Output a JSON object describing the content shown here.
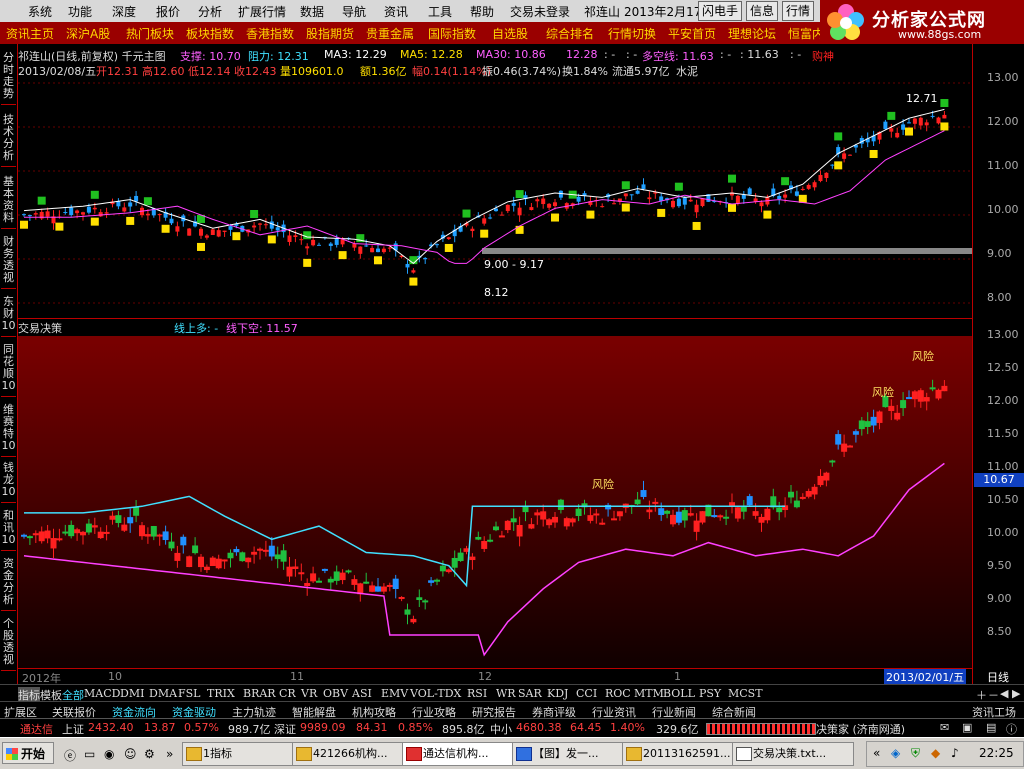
{
  "menu": {
    "items": [
      "系统",
      "功能",
      "深度",
      "报价",
      "分析",
      "扩展行情",
      "数据",
      "导航",
      "资讯",
      "工具",
      "帮助",
      "交易未登录"
    ],
    "stock": "祁连山",
    "date": "2013年2月17日",
    "buttons": [
      "闪电手",
      "信息",
      "行情"
    ]
  },
  "logo": {
    "text": "分析家公式网",
    "url": "www.88gs.com"
  },
  "nav": [
    "资讯主页",
    "深沪A股",
    "热门板块",
    "板块指数",
    "香港指数",
    "股指期货",
    "贵重金属",
    "国际指数",
    "自选股",
    "综合排名",
    "行情切换",
    "平安首页",
    "理想论坛",
    "恒富内"
  ],
  "sidebar": [
    "分时走势",
    "技术分析",
    "基本资料",
    "财务透视",
    "东财10",
    "同花顺10",
    "维赛特10",
    "钱龙10",
    "和讯10",
    "资金分析",
    "个股透视"
  ],
  "upper": {
    "title": "祁连山(日线,前复权) 千元主图",
    "support": "支撑: 10.70",
    "resist": "阻力: 12.31",
    "ma3": "MA3: 12.29",
    "ma5": "MA5: 12.28",
    "ma30": "MA30: 10.86",
    "v1228": "12.28",
    "dash1": ": -",
    "dash2": ": -",
    "dk": "多空线: 11.63",
    "dash3": ": -",
    "v1163": ": 11.63",
    "dash4": ": -",
    "buy": "购神",
    "date": "2013/02/08/五",
    "open": "开12.31",
    "high": "高12.60",
    "low": "低12.14",
    "close": "收12.43",
    "vol": "量109601.0",
    "amt": "额1.36亿",
    "rng": "幅0.14(1.14%)",
    "amp": "振0.46(3.74%)",
    "turn": "换1.84%",
    "cap": "流通5.97亿",
    "ind": "水泥",
    "ann_range": "9.00 - 9.17",
    "ann_low": "8.12",
    "ann_high": "12.71",
    "axis": [
      "13.00",
      "12.00",
      "11.00",
      "10.00",
      "9.00",
      "8.00"
    ]
  },
  "lower": {
    "title": "交易决策",
    "line_up": "线上多: -",
    "line_down": "线下空: 11.57",
    "risk": "风险",
    "axis": [
      "13.00",
      "12.50",
      "12.00",
      "11.50",
      "11.00",
      "10.50",
      "10.00",
      "9.50",
      "9.00",
      "8.50"
    ],
    "price_tag": "10.67"
  },
  "timeline": {
    "labels": [
      "2012年",
      "10",
      "11",
      "12",
      "1"
    ],
    "date": "2013/02/01/五",
    "period": "日线"
  },
  "indicators": [
    "指标",
    "模板",
    "全部",
    "MACD",
    "DMI",
    "DMA",
    "FSL",
    "TRIX",
    "BRAR",
    "CR",
    "VR",
    "OBV",
    "ASI",
    "EMV",
    "VOL-TDX",
    "RSI",
    "WR",
    "SAR",
    "KDJ",
    "CCI",
    "ROC",
    "MTM",
    "BOLL",
    "PSY",
    "MCST"
  ],
  "extbar": [
    "扩展区",
    "关联报价",
    "资金流向",
    "资金驱动",
    "主力轨迹",
    "智能解盘",
    "机构攻略",
    "行业攻略",
    "研究报告",
    "券商评级",
    "行业资讯",
    "行业新闻",
    "综合新闻"
  ],
  "extbar_right": "资讯工场",
  "quote": {
    "name": "通达信",
    "sh": "上证",
    "sh_val": "2432.40",
    "sh_chg": "13.87",
    "sh_pct": "0.57%",
    "sh_amt": "989.7亿",
    "sz": "深证",
    "sz_val": "9989.09",
    "sz_chg": "84.31",
    "sz_pct": "0.85%",
    "sz_amt": "895.8亿",
    "zx": "中小",
    "zx_val": "4680.38",
    "zx_chg": "64.45",
    "zx_pct": "1.40%",
    "zx_amt": "329.6亿",
    "right": "决策家 (济南网通)"
  },
  "taskbar": {
    "start": "开始",
    "tasks": [
      "1指标",
      "421266机构...",
      "通达信机构...",
      "【图】发一...",
      "20113162591...",
      "交易决策.txt..."
    ],
    "time": "22:25"
  },
  "colors": {
    "up": "#ff2020",
    "down": "#00c000",
    "magenta": "#ff40ff",
    "cyan": "#40e0ff",
    "yellow": "#ffe000",
    "blue": "#2090ff"
  }
}
